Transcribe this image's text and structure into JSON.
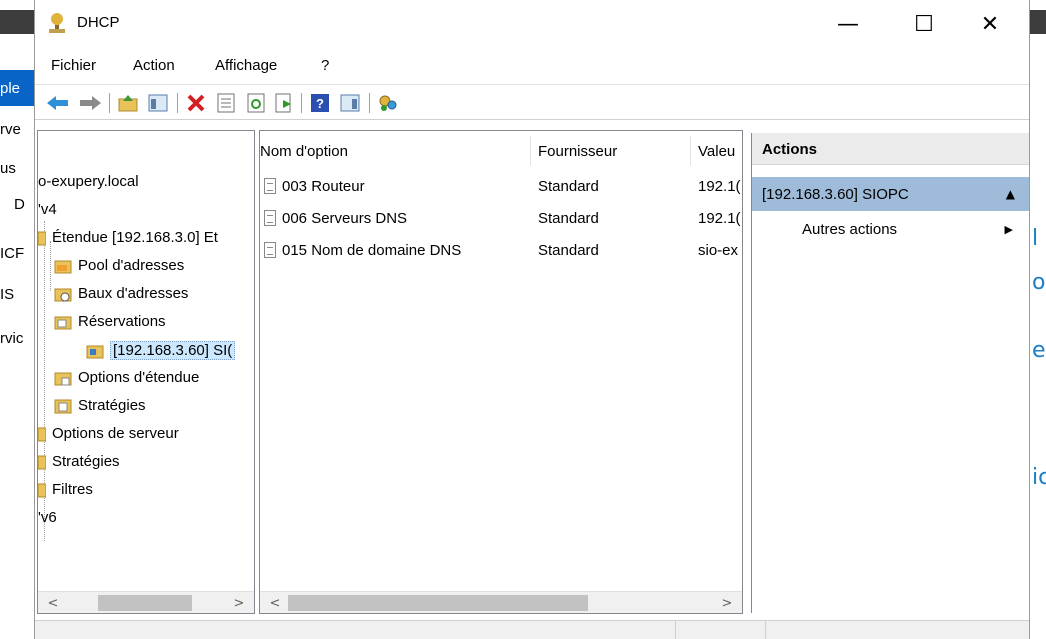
{
  "window": {
    "title": "DHCP",
    "minimize": "—",
    "maximize": "☐",
    "close": "✕"
  },
  "menu": {
    "items": [
      "Fichier",
      "Action",
      "Affichage",
      "?"
    ]
  },
  "toolbar": {
    "icons": [
      "back-arrow-icon",
      "forward-arrow-icon",
      "up-folder-icon",
      "show-hide-tree-icon",
      "delete-icon",
      "properties-icon",
      "refresh-icon",
      "export-list-icon",
      "help-icon",
      "show-hide-action-pane-icon",
      "dhcp-server-icon"
    ]
  },
  "tree": {
    "items": [
      {
        "label": "o-exupery.local",
        "icon": "none"
      },
      {
        "label": "'v4",
        "icon": "none"
      },
      {
        "label": "Étendue [192.168.3.0] Et",
        "icon": "folder-icon"
      },
      {
        "label": "Pool d'adresses",
        "icon": "pool-folder-icon"
      },
      {
        "label": "Baux d'adresses",
        "icon": "leases-folder-icon"
      },
      {
        "label": "Réservations",
        "icon": "reservations-folder-icon"
      },
      {
        "label": "[192.168.3.60] SI(",
        "icon": "reservation-icon"
      },
      {
        "label": "Options d'étendue",
        "icon": "scope-options-icon"
      },
      {
        "label": "Stratégies",
        "icon": "policies-icon"
      },
      {
        "label": "Options de serveur",
        "icon": "folder-icon"
      },
      {
        "label": "Stratégies",
        "icon": "folder-icon"
      },
      {
        "label": "Filtres",
        "icon": "folder-icon"
      },
      {
        "label": "'v6",
        "icon": "none"
      }
    ]
  },
  "list": {
    "columns": [
      "Nom d'option",
      "Fournisseur",
      "Valeu"
    ],
    "rows": [
      {
        "name": "003 Routeur",
        "vendor": "Standard",
        "value": "192.1("
      },
      {
        "name": "006 Serveurs DNS",
        "vendor": "Standard",
        "value": "192.1("
      },
      {
        "name": "015 Nom de domaine DNS",
        "vendor": "Standard",
        "value": "sio-ex"
      }
    ]
  },
  "actions": {
    "header": "Actions",
    "group": "[192.168.3.60] SIOPC",
    "group_toggle": "▲",
    "item": "Autres actions",
    "item_arrow": "▶"
  },
  "scrollbar": {
    "left": "<",
    "right": ">"
  },
  "background": {
    "left_fragments": [
      "ple",
      "rve",
      "us",
      "D",
      "ICF",
      "IS",
      "rvic"
    ],
    "right_fragments": [
      "l",
      "or",
      "e",
      "ic"
    ]
  }
}
